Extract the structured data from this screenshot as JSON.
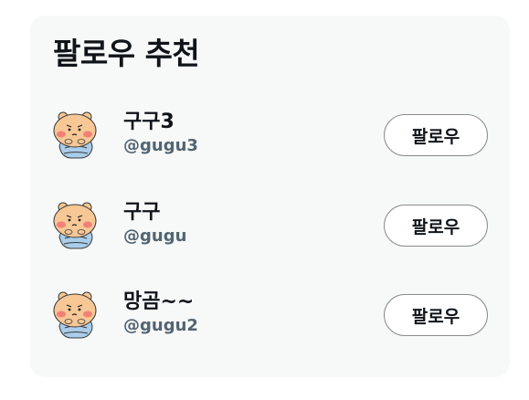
{
  "panel": {
    "title": "팔로우 추천",
    "users": [
      {
        "display_name": "구구3",
        "handle": "@gugu3",
        "button_label": "팔로우"
      },
      {
        "display_name": "구구",
        "handle": "@gugu",
        "button_label": "팔로우"
      },
      {
        "display_name": "망곰~~",
        "handle": "@gugu2",
        "button_label": "팔로우"
      }
    ]
  },
  "colors": {
    "card_background": "#f7f9f9",
    "primary_text": "#0f1419",
    "secondary_text": "#536471",
    "button_border": "#8a8a8a"
  },
  "icons": {
    "avatar": "cartoon-hamster-avatar-icon"
  }
}
